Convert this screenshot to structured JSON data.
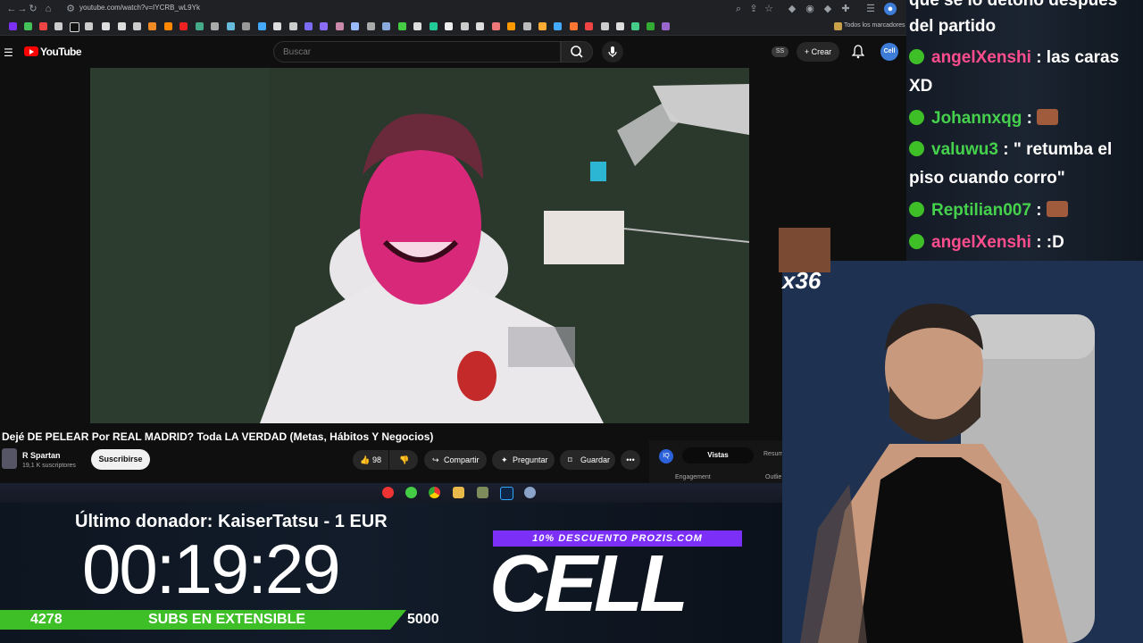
{
  "browser": {
    "url": "youtube.com/watch?v=IYCRB_wL9Yk",
    "bookmarks_all_label": "Todos los marcadores"
  },
  "youtube": {
    "logo_text": "YouTube",
    "search_placeholder": "Buscar",
    "ss_badge": "SS",
    "create_label": "+ Crear",
    "avatar_text": "Cell"
  },
  "video": {
    "title": "Dejé DE PELEAR Por REAL MADRID? Toda LA VERDAD (Metas, Hábitos Y Negocios)",
    "channel_name": "R Spartan",
    "subscribers": "19,1 K suscriptores",
    "subscribe_label": "Suscribirse",
    "likes": "98",
    "share_label": "Compartir",
    "ask_label": "Preguntar",
    "save_label": "Guardar"
  },
  "extension_panel": {
    "icon_text": "IQ",
    "views_tab": "Vistas",
    "summary_tab": "Resum",
    "engagement_label": "Engagement",
    "outlier_label": "Outlie"
  },
  "overlay": {
    "last_donor": "Último donador: KaiserTatsu - 1 EUR",
    "timer": "00:19:29",
    "subs_current": "4278",
    "subs_label": "SUBS EN EXTENSIBLE",
    "subs_goal": "5000",
    "subs_progress": 0.856,
    "promo": "10% DESCUENTO PROZIS.COM",
    "brand": "CELL"
  },
  "chat": {
    "messages": [
      {
        "user": "",
        "text": "que se lo detonó después"
      },
      {
        "user": "",
        "text": "del partido"
      },
      {
        "user": "angelXenshi",
        "text": " : las caras"
      },
      {
        "user": "",
        "text": "XD"
      },
      {
        "user": "Johannxqg",
        "text": " : "
      },
      {
        "user": "valuwu3",
        "text": " : \" retumba el"
      },
      {
        "user": "",
        "text": "piso cuando corro\""
      },
      {
        "user": "Reptilian007",
        "text": " : "
      },
      {
        "user": "angelXenshi",
        "text": " : :D"
      }
    ],
    "emote_combo": "x36"
  },
  "colors": {
    "youtube_red": "#ff0000",
    "subs_bar_green": "#3fbf27",
    "promo_purple": "#7b2ff7",
    "chat_user_pink": "#ff4d8d",
    "chat_user_green": "#46d14d"
  }
}
